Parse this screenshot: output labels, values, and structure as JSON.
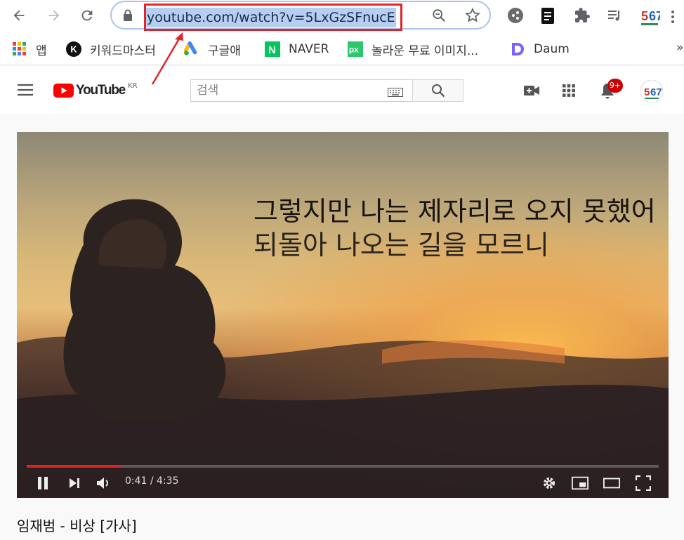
{
  "browser": {
    "url": "youtube.com/watch?v=5LxGzSFnucE",
    "bookmarks": [
      {
        "label": "앱",
        "icon": "apps-grid-icon"
      },
      {
        "label": "키워드마스터",
        "icon": "k-logo-icon"
      },
      {
        "label": "구글애",
        "icon": "google-ads-icon"
      },
      {
        "label": "NAVER",
        "icon": "naver-icon"
      },
      {
        "label": "놀라운 무료 이미지...",
        "icon": "pixabay-icon"
      },
      {
        "label": "Daum",
        "icon": "daum-icon"
      }
    ],
    "overflow": "»"
  },
  "youtube": {
    "logo_text": "YouTube",
    "region": "KR",
    "search_placeholder": "검색",
    "notification_count": "9+"
  },
  "video": {
    "lyric_line1": "그렇지만 나는 제자리로 오지 못했어",
    "lyric_line2": "되돌아 나오는 길을 모르니",
    "time": "0:41 / 4:35",
    "progress_fraction": 0.149,
    "title": "임재범 - 비상 [가사]"
  },
  "colors": {
    "highlight_box": "#e0262b",
    "youtube_red": "#ff0000",
    "selection": "#b7cef3"
  }
}
